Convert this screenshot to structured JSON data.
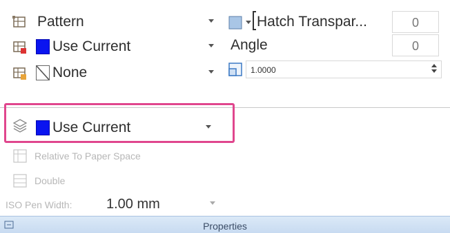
{
  "row1": {
    "label": "Pattern",
    "right_label": "Hatch Transpar...",
    "right_value": "0"
  },
  "row2": {
    "label": "Use Current",
    "right_label": "Angle",
    "right_value": "0"
  },
  "row3": {
    "label": "None",
    "right_value": "1.0000"
  },
  "bg_color": {
    "label": "Use Current"
  },
  "relative_label": "Relative To Paper Space",
  "double_label": "Double",
  "pen_width": {
    "label": "ISO Pen Width:",
    "value": "1.00 mm"
  },
  "panel_title": "Properties",
  "colors": {
    "blue_swatch": "#0a14f0",
    "highlight": "#e0468d",
    "panel_bar": "#c8dbf1"
  }
}
